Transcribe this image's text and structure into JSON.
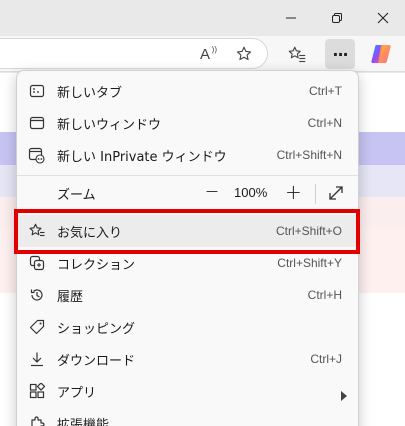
{
  "toolbar": {
    "read_aloud_label": "A",
    "more_menu_label": "···"
  },
  "menu": {
    "items": [
      {
        "label": "新しいタブ",
        "shortcut": "Ctrl+T",
        "icon": "new-tab-icon"
      },
      {
        "label": "新しいウィンドウ",
        "shortcut": "Ctrl+N",
        "icon": "new-window-icon"
      },
      {
        "label": "新しい InPrivate ウィンドウ",
        "shortcut": "Ctrl+Shift+N",
        "icon": "inprivate-icon"
      },
      {
        "label": "お気に入り",
        "shortcut": "Ctrl+Shift+O",
        "icon": "favorites-icon"
      },
      {
        "label": "コレクション",
        "shortcut": "Ctrl+Shift+Y",
        "icon": "collections-icon"
      },
      {
        "label": "履歴",
        "shortcut": "Ctrl+H",
        "icon": "history-icon"
      },
      {
        "label": "ショッピング",
        "shortcut": "",
        "icon": "shopping-tag-icon"
      },
      {
        "label": "ダウンロード",
        "shortcut": "Ctrl+J",
        "icon": "download-icon"
      },
      {
        "label": "アプリ",
        "shortcut": "",
        "icon": "apps-icon"
      },
      {
        "label": "拡張機能",
        "shortcut": "",
        "icon": "extensions-icon"
      }
    ],
    "zoom": {
      "label": "ズーム",
      "minus": "—",
      "value": "100%",
      "plus": "+"
    }
  },
  "colors": {
    "highlight": "#e00000",
    "menu_bg": "#f9f9f9"
  }
}
